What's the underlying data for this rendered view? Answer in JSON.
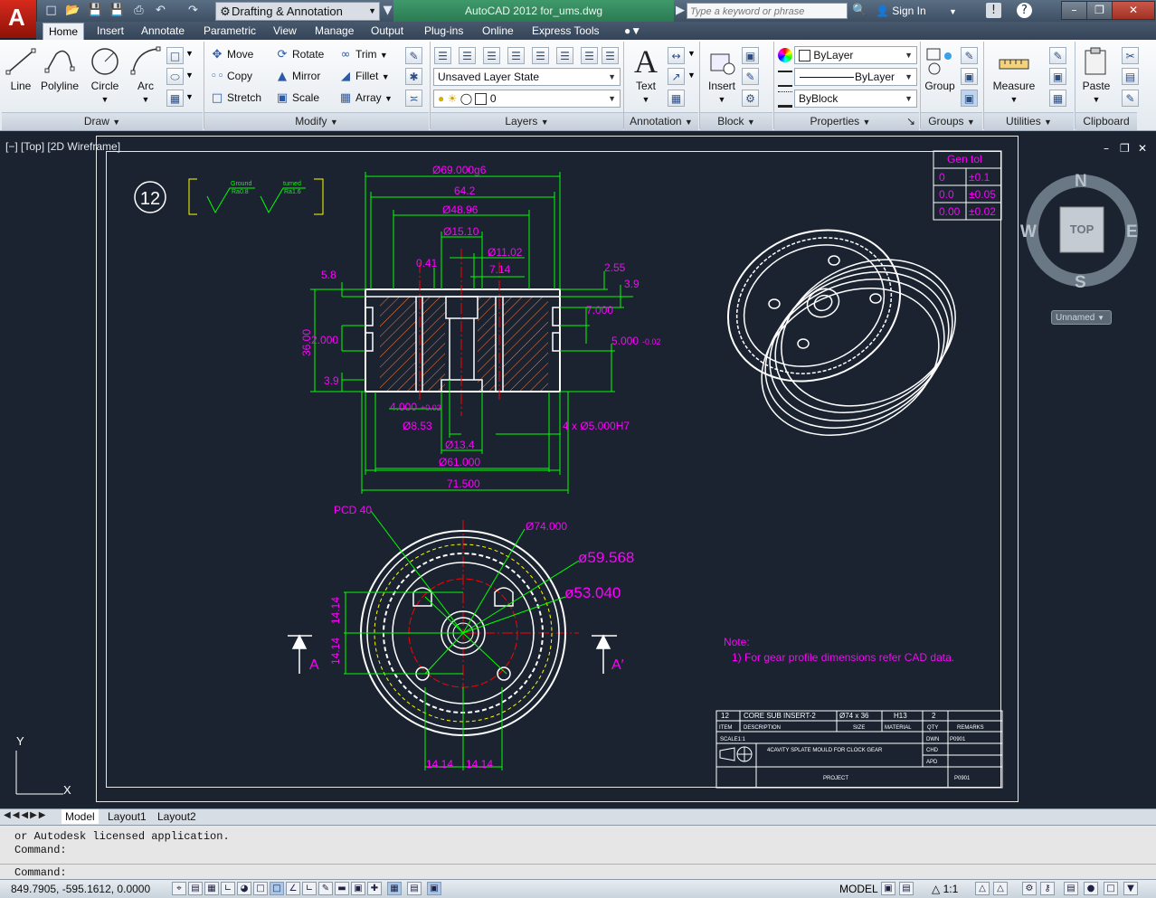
{
  "title_bar": {
    "workspace": "Drafting & Annotation",
    "app_title": "AutoCAD 2012   for_ums.dwg",
    "search_placeholder": "Type a keyword or phrase",
    "sign_in": "Sign In"
  },
  "tabs": [
    "Home",
    "Insert",
    "Annotate",
    "Parametric",
    "View",
    "Manage",
    "Output",
    "Plug-ins",
    "Online",
    "Express Tools"
  ],
  "ribbon": {
    "draw": {
      "line": "Line",
      "polyline": "Polyline",
      "circle": "Circle",
      "arc": "Arc",
      "footer": "Draw"
    },
    "modify": {
      "move": "Move",
      "rotate": "Rotate",
      "trim": "Trim",
      "copy": "Copy",
      "mirror": "Mirror",
      "fillet": "Fillet",
      "stretch": "Stretch",
      "scale": "Scale",
      "array": "Array",
      "footer": "Modify"
    },
    "layers": {
      "state": "Unsaved Layer State",
      "current": "0",
      "footer": "Layers"
    },
    "annotation": {
      "text": "Text",
      "footer": "Annotation"
    },
    "block": {
      "insert": "Insert",
      "footer": "Block"
    },
    "properties": {
      "color": "ByLayer",
      "linetype": "ByLayer",
      "lineweight": "ByBlock",
      "footer": "Properties"
    },
    "groups": {
      "group": "Group",
      "footer": "Groups"
    },
    "utilities": {
      "measure": "Measure",
      "footer": "Utilities"
    },
    "clipboard": {
      "paste": "Paste",
      "footer": "Clipboard"
    }
  },
  "viewport_label": "[−] [Top] [2D Wireframe]",
  "viewcube": {
    "n": "N",
    "s": "S",
    "e": "E",
    "w": "W",
    "face": "TOP",
    "ucs": "Unnamed"
  },
  "drawing": {
    "item_no": "12",
    "surface_symbols": [
      {
        "label": "Ground",
        "value": "Ra0.8"
      },
      {
        "label": "turned",
        "value": "Ra1.6"
      }
    ],
    "gen_tol": {
      "header": "Gen tol",
      "rows": [
        [
          "0",
          "±0.1"
        ],
        [
          "0.0",
          "±0.05"
        ],
        [
          "0.00",
          "±0.02"
        ]
      ]
    },
    "dims_section": {
      "d69": "Ø69.000g6",
      "d64": "64.2",
      "d48": "Ø48.96",
      "d15": "Ø15.10",
      "d11": "Ø11.02",
      "d041": "0.41",
      "d714": "7.14",
      "d255": "2.55",
      "d58": "5.8",
      "d39r": "3.9",
      "d7": "7.000",
      "d36": "36.00",
      "d2": "2.000",
      "d5": "5.000",
      "d5tol": "-0.02",
      "d39l": "3.9",
      "d4": "4.000",
      "d4tol": "+0.02",
      "d853": "Ø8.53",
      "d4x5": "4 x Ø5.000H7",
      "d134": "Ø13.4",
      "d61": "Ø61.000",
      "d715": "71.500"
    },
    "dims_plan": {
      "pcd": "PCD 40",
      "d74": "Ø74.000",
      "d59": "ø59.568",
      "d53": "ø53.040",
      "h1414a": "14.14",
      "h1414b": "14.14",
      "b1414a": "14.14",
      "b1414b": "14.14",
      "sec_a": "A",
      "sec_a2": "A′"
    },
    "note": {
      "title": "Note:",
      "line1": "1) For gear profile dimensions refer CAD data."
    },
    "title_block": {
      "item": "12",
      "desc": "CORE SUB INSERT-2",
      "size": "Ø74 x 36",
      "material": "H13",
      "qty": "2",
      "h_item": "ITEM",
      "h_desc": "DESCRIPTION",
      "h_size": "SIZE",
      "h_material": "MATERIAL",
      "h_qty": "QTY",
      "h_remarks": "REMARKS",
      "scale": "SCALE1:1",
      "project_title": "4CAVITY SPLATE MOULD FOR CLOCK GEAR",
      "dwn": "DWN",
      "dwn_val": "P0901",
      "chd": "CHD",
      "apd": "APD",
      "project": "PROJECT",
      "project_val": "P0901"
    },
    "ucs_y": "Y",
    "ucs_x": "X"
  },
  "layout_tabs": [
    "Model",
    "Layout1",
    "Layout2"
  ],
  "command": {
    "history1": "or Autodesk licensed application.",
    "history2": "Command:",
    "prompt": "Command:"
  },
  "status": {
    "coords": "849.7905, -595.1612, 0.0000",
    "model": "MODEL",
    "scale": "1:1"
  },
  "colors": {
    "magenta": "#ff00ff",
    "green": "#00ff00",
    "white": "#ffffff",
    "red": "#ff0000",
    "yellow": "#ffff00",
    "bg": "#1b2331"
  }
}
